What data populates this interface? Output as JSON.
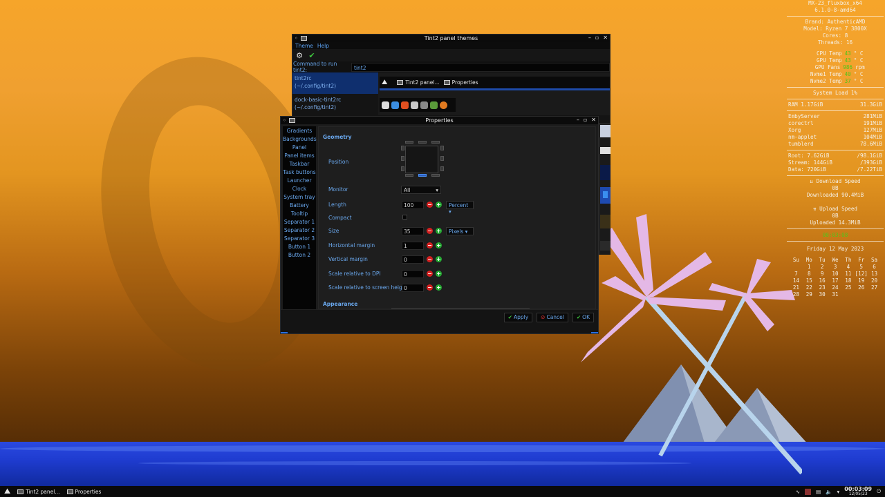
{
  "conky": {
    "host": "MX-23_fluxbox_x64",
    "kernel": "6.1.0-8-amd64",
    "brand": "Brand: AuthenticAMD",
    "model": "Model: Ryzen 7 3800X",
    "cores": "Cores: 8",
    "threads": "Threads: 16",
    "temps": [
      {
        "label": "CPU Temp",
        "value": "43",
        "unit": "° C"
      },
      {
        "label": "GPU Temp",
        "value": "43",
        "unit": "° C"
      },
      {
        "label": "GPU Fans",
        "value": "986",
        "unit": "rpm"
      },
      {
        "label": "Nvme1 Temp",
        "value": "40",
        "unit": "° C"
      },
      {
        "label": "Nvme2 Temp",
        "value": "37",
        "unit": "° C"
      }
    ],
    "system_load": "System Load  1%",
    "ram_label": "RAM  1.17GiB",
    "ram_total": "31.3GiB",
    "procs": [
      {
        "name": "EmbyServer",
        "mem": "281MiB"
      },
      {
        "name": "corectrl",
        "mem": "191MiB"
      },
      {
        "name": "Xorg",
        "mem": "127MiB"
      },
      {
        "name": "nm-applet",
        "mem": "104MiB"
      },
      {
        "name": "tumblerd",
        "mem": "78.6MiB"
      }
    ],
    "disks": [
      {
        "name": "Root:  7.62GiB",
        "total": "/98.1GiB"
      },
      {
        "name": "Stream: 144GiB",
        "total": "/393GiB"
      },
      {
        "name": "Data:  720GiB",
        "total": "/7.22TiB"
      }
    ],
    "download_title": "⇊ Download Speed",
    "download_speed": "0B",
    "downloaded": "Downloaded 90.4MiB",
    "upload_title": "⇈ Upload Speed",
    "upload_speed": "0B",
    "uploaded": "Uploaded 14.3MiB",
    "uptime": "00:03:08",
    "date": "Friday 12 May 2023",
    "cal_head": [
      "Su",
      "Mo",
      "Tu",
      "We",
      "Th",
      "Fr",
      "Sa"
    ],
    "cal_rows": [
      [
        "",
        "1",
        "2",
        "3",
        "4",
        "5",
        "6"
      ],
      [
        "7",
        "8",
        "9",
        "10",
        "11",
        "[12]",
        "13"
      ],
      [
        "14",
        "15",
        "16",
        "17",
        "18",
        "19",
        "20"
      ],
      [
        "21",
        "22",
        "23",
        "24",
        "25",
        "26",
        "27"
      ],
      [
        "28",
        "29",
        "30",
        "31",
        "",
        "",
        ""
      ]
    ]
  },
  "themes_window": {
    "title": "Tint2 panel themes",
    "menu": [
      "Theme",
      "Help"
    ],
    "cmd_label": "Command to run tint2:",
    "cmd_value": "tint2",
    "themes": [
      {
        "name": "tint2rc",
        "path": "(~/.config/tint2)"
      },
      {
        "name": "dock-basic-tint2rc",
        "path": "(~/.config/tint2)"
      }
    ],
    "preview_tasks": [
      "Tint2 panel...",
      "Properties"
    ]
  },
  "properties_window": {
    "title": "Properties",
    "sidebar": [
      "Gradients",
      "Backgrounds",
      "Panel",
      "Panel items",
      "Taskbar",
      "Task buttons",
      "Launcher",
      "Clock",
      "System tray",
      "Battery",
      "Tooltip",
      "Separator 1",
      "Separator 2",
      "Separator 3",
      "Button 1",
      "Button 2"
    ],
    "geometry_title": "Geometry",
    "appearance_title": "Appearance",
    "labels": {
      "position": "Position",
      "monitor": "Monitor",
      "length": "Length",
      "compact": "Compact",
      "size": "Size",
      "hmargin": "Horizontal margin",
      "vmargin": "Vertical margin",
      "dpi": "Scale relative to DPI",
      "screen_h": "Scale relative to screen height"
    },
    "values": {
      "monitor": "All",
      "length": "100",
      "length_unit": "Percent",
      "size": "35",
      "size_unit": "Pixels",
      "hmargin": "1",
      "vmargin": "0",
      "dpi": "0",
      "screen_h": "0"
    },
    "buttons": {
      "apply": "Apply",
      "cancel": "Cancel",
      "ok": "OK"
    }
  },
  "taskbar": {
    "tasks": [
      "Tint2 panel...",
      "Properties"
    ],
    "time": "00:03:09",
    "date": "12/05/23"
  },
  "colors": {
    "accent": "#6aa8ee",
    "selection": "#0f2f6e",
    "minus": "#d32020",
    "plus": "#24a832"
  }
}
